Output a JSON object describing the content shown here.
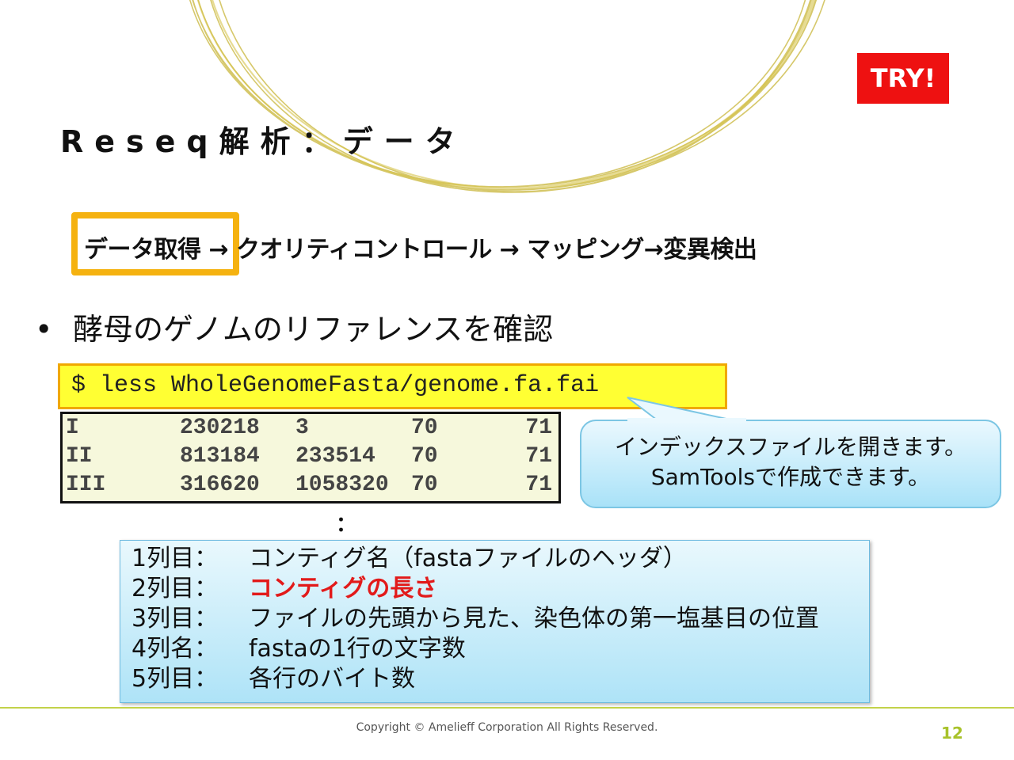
{
  "badge": {
    "label": "TRY!"
  },
  "title": "Reseq解析：データ",
  "flow": {
    "step1": "データ取得",
    "sep1": " → ",
    "step2": "クオリティコントロール",
    "sep2": " → ",
    "step3": "マッピング",
    "sep3": "→",
    "step4": "変異検出"
  },
  "bullet": {
    "marker": "•",
    "text": "酵母のゲノムのリファレンスを確認"
  },
  "command": "$ less WholeGenomeFasta/genome.fa.fai",
  "fai_rows": [
    {
      "name": "I",
      "length": "230218",
      "offset": "3",
      "linebases": "70",
      "linewidth": "71"
    },
    {
      "name": "II",
      "length": "813184",
      "offset": "233514",
      "linebases": "70",
      "linewidth": "71"
    },
    {
      "name": "III",
      "length": "316620",
      "offset": "1058320",
      "linebases": "70",
      "linewidth": "71"
    }
  ],
  "callout": {
    "line1": "インデックスファイルを開きます。",
    "line2": "SamToolsで作成できます。"
  },
  "ellipsis": "：",
  "columns": [
    {
      "label": "1列目：",
      "text": "コンティグ名（fastaファイルのヘッダ）",
      "highlight": false
    },
    {
      "label": "2列目：",
      "text": "コンティグの長さ",
      "highlight": true
    },
    {
      "label": "3列目：",
      "text": "ファイルの先頭から見た、染色体の第一塩基目の位置",
      "highlight": false
    },
    {
      "label": "4列名：",
      "text": "fastaの1行の文字数",
      "highlight": false
    },
    {
      "label": "5列目：",
      "text": "各行のバイト数",
      "highlight": false
    }
  ],
  "footer": {
    "copyright": "Copyright © Amelieff Corporation All Rights Reserved.",
    "page": "12"
  },
  "colors": {
    "accent": "#f5b210",
    "badge": "#ee1111",
    "highlight": "#e21a1a",
    "line": "#c3d24a"
  }
}
